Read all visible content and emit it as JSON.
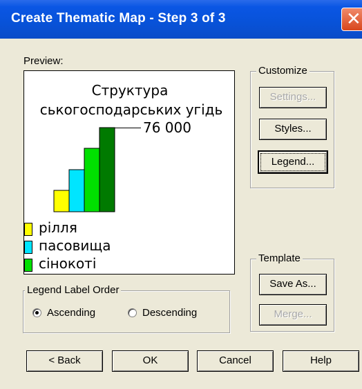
{
  "window": {
    "title": "Create Thematic Map - Step 3 of 3",
    "close_glyph": "✕"
  },
  "preview": {
    "label": "Preview:",
    "chart_title_line1": "Структура",
    "chart_title_line2": "ськогосподарських угідь",
    "value_label": "76 000",
    "bars": [
      {
        "color": "#ffff00",
        "value": 0.25
      },
      {
        "color": "#00e5ff",
        "value": 0.5
      },
      {
        "color": "#00e000",
        "value": 0.75
      },
      {
        "color": "#007a00",
        "value": 1.0
      }
    ],
    "legend": [
      {
        "label": "рілля",
        "color": "#ffff00"
      },
      {
        "label": "пасовища",
        "color": "#00e5ff"
      },
      {
        "label": "сінокоті",
        "color": "#00e000"
      }
    ]
  },
  "customize": {
    "title": "Customize",
    "settings_label": "Settings...",
    "styles_label": "Styles...",
    "legend_label": "Legend..."
  },
  "template": {
    "title": "Template",
    "save_as_label": "Save As...",
    "merge_label": "Merge..."
  },
  "legend_order": {
    "title": "Legend Label Order",
    "ascending_label": "Ascending",
    "descending_label": "Descending",
    "selected": "ascending"
  },
  "footer": {
    "back_label": "< Back",
    "ok_label": "OK",
    "cancel_label": "Cancel",
    "help_label": "Help"
  }
}
